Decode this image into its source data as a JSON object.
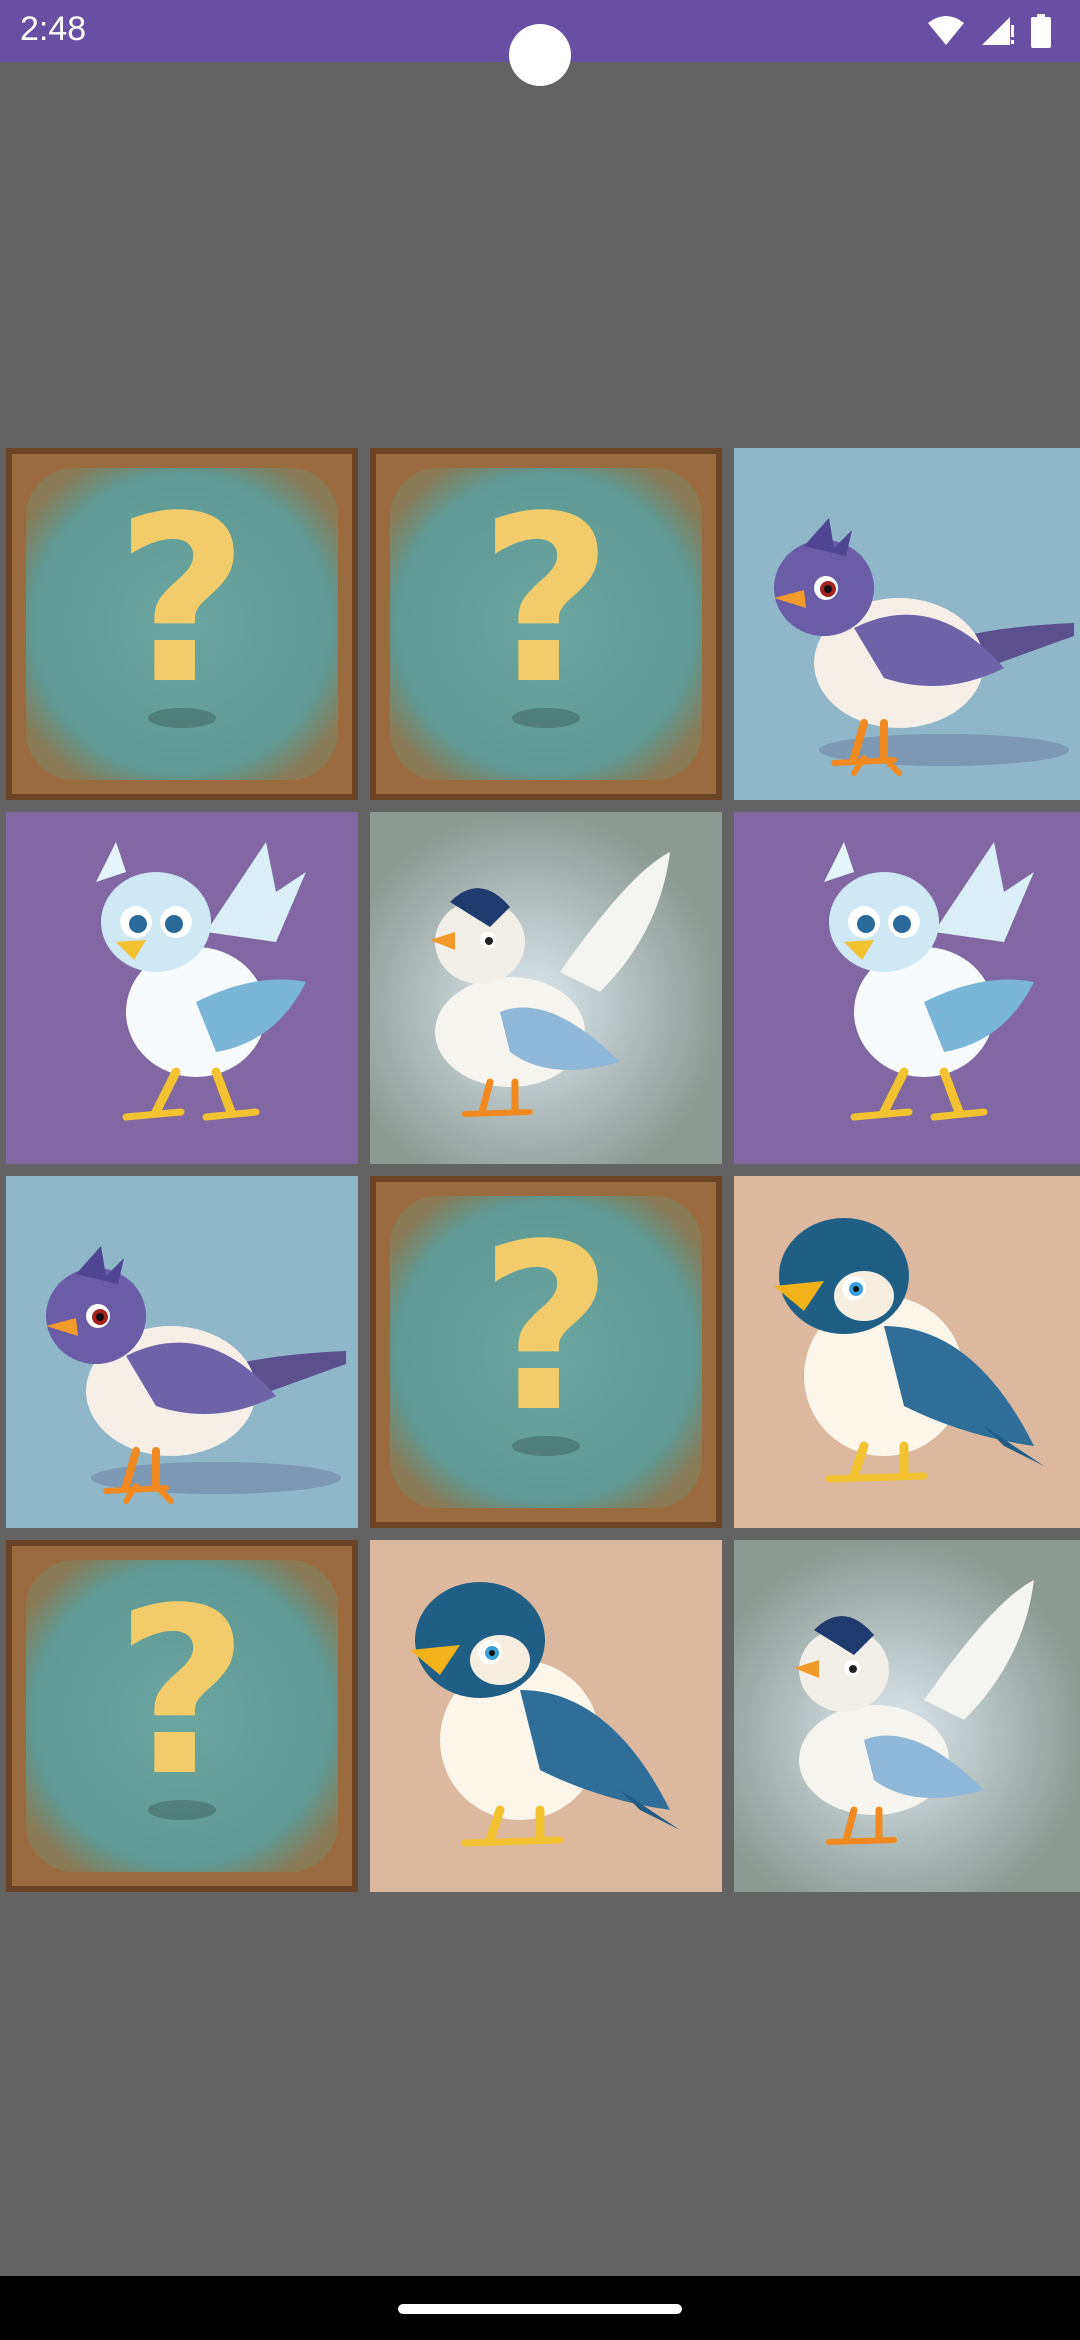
{
  "status_bar": {
    "time": "2:48",
    "icons": [
      "wifi-icon",
      "cellular-signal-icon",
      "battery-icon"
    ],
    "background": "#6750a4"
  },
  "board": {
    "background": "#636363",
    "columns": 3,
    "rows": 4,
    "cards": [
      {
        "state": "face-down"
      },
      {
        "state": "face-down"
      },
      {
        "state": "face-up",
        "bird": "purple-crested-bird",
        "background": "#8fb6c9"
      },
      {
        "state": "face-up",
        "bird": "light-blue-winged-bird",
        "background": "#8168a2"
      },
      {
        "state": "face-up",
        "bird": "white-winged-dove",
        "background": "#8d9a94"
      },
      {
        "state": "face-up",
        "bird": "light-blue-winged-bird",
        "background": "#8168a2"
      },
      {
        "state": "face-up",
        "bird": "purple-crested-bird",
        "background": "#8fb6c9"
      },
      {
        "state": "face-down"
      },
      {
        "state": "face-up",
        "bird": "dark-teal-bird",
        "background": "#dcb89e"
      },
      {
        "state": "face-down"
      },
      {
        "state": "face-up",
        "bird": "dark-teal-bird",
        "background": "#dcb89e"
      },
      {
        "state": "face-up",
        "bird": "white-winged-dove",
        "background": "#8d9a94"
      }
    ]
  },
  "card_back": {
    "symbol": "?",
    "frame_color": "#6b4428",
    "panel_color": "#6aa7a0",
    "symbol_color": "#f2cc6a"
  }
}
